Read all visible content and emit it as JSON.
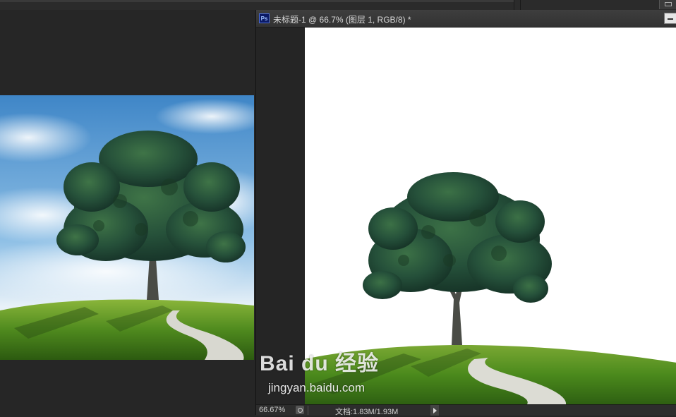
{
  "document": {
    "title": "未标题-1 @ 66.7% (图层 1, RGB/8) *",
    "app_icon_text": "Ps"
  },
  "statusbar": {
    "zoom": "66.67%",
    "doc_info": "文档:1.83M/1.93M"
  },
  "watermark": {
    "logo_text": "Bai du 经验",
    "url": "jingyan.baidu.com"
  },
  "icons": {
    "app": "photoshop-icon",
    "minimize": "minimize-icon",
    "status": "document-profile-icon",
    "arrow": "play-arrow-icon",
    "panel": "panel-collapse-icon"
  }
}
